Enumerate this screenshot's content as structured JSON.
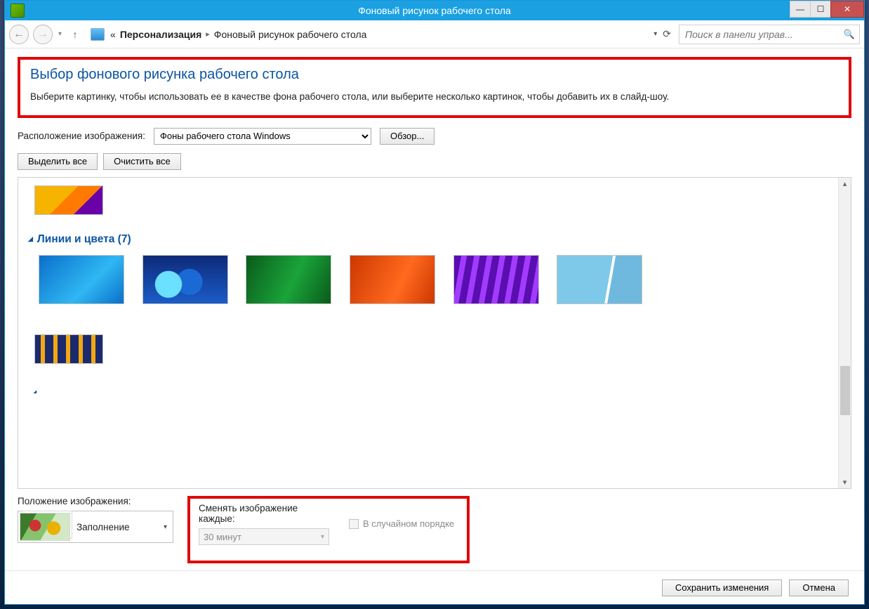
{
  "window": {
    "title": "Фоновый рисунок рабочего стола"
  },
  "nav": {
    "breadcrumb_prefix": "«",
    "segment1": "Персонализация",
    "segment2": "Фоновый рисунок рабочего стола",
    "search_placeholder": "Поиск в панели управ..."
  },
  "hero": {
    "title": "Выбор фонового рисунка рабочего стола",
    "subtitle": "Выберите картинку, чтобы использовать ее в качестве фона рабочего стола, или выберите несколько картинок, чтобы добавить их в слайд-шоу."
  },
  "location": {
    "label": "Расположение изображения:",
    "value": "Фоны рабочего стола Windows",
    "browse": "Обзор..."
  },
  "selection_buttons": {
    "select_all": "Выделить все",
    "clear_all": "Очистить все"
  },
  "group": {
    "title": "Линии и цвета (7)"
  },
  "position": {
    "label": "Положение изображения:",
    "value": "Заполнение"
  },
  "interval": {
    "label": "Сменять изображение каждые:",
    "value": "30 минут",
    "shuffle": "В случайном порядке"
  },
  "footer": {
    "save": "Сохранить изменения",
    "cancel": "Отмена"
  }
}
